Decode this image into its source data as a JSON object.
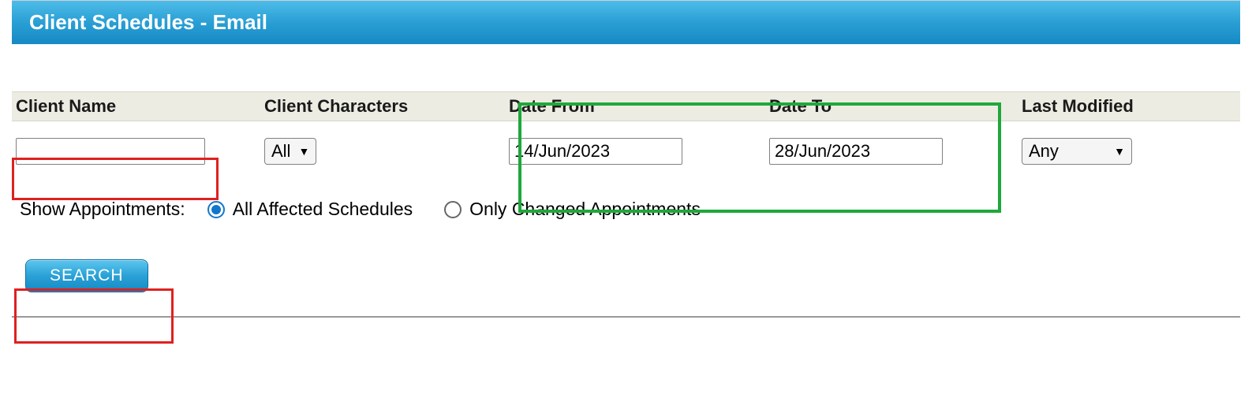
{
  "header": {
    "title": "Client Schedules - Email"
  },
  "filters": {
    "client_name": {
      "label": "Client Name",
      "value": ""
    },
    "client_characters": {
      "label": "Client Characters",
      "value": "All"
    },
    "date_from": {
      "label": "Date From",
      "value": "14/Jun/2023"
    },
    "date_to": {
      "label": "Date To",
      "value": "28/Jun/2023"
    },
    "last_modified": {
      "label": "Last Modified",
      "value": "Any"
    }
  },
  "show_appointments": {
    "label": "Show Appointments:",
    "options": {
      "all": {
        "label": "All Affected Schedules",
        "selected": true
      },
      "changed": {
        "label": "Only Changed Appointments",
        "selected": false
      }
    }
  },
  "actions": {
    "search": "SEARCH"
  }
}
